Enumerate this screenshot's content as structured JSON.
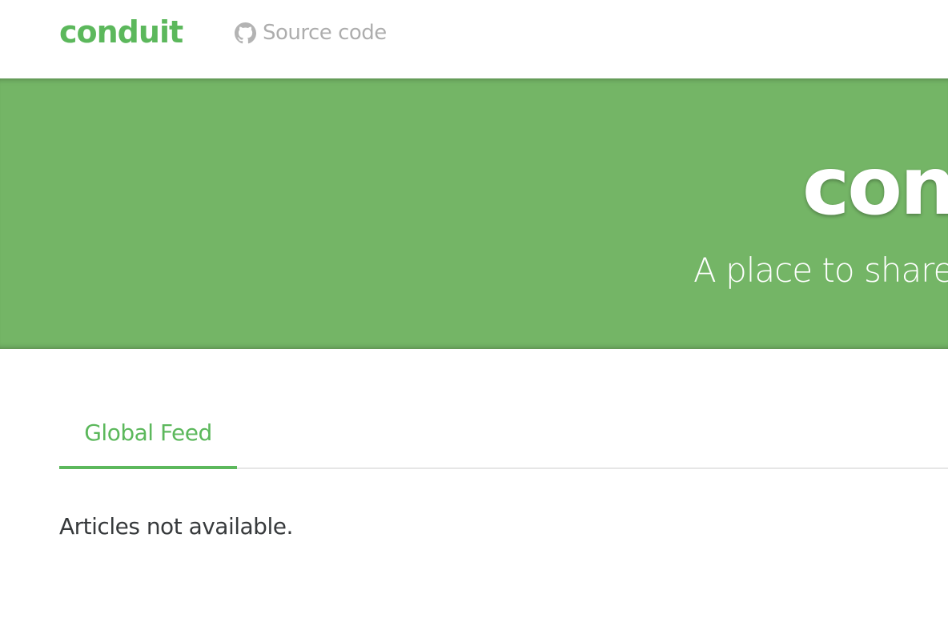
{
  "navbar": {
    "brand": "conduit",
    "source_link_label": "Source code",
    "source_icon": "github-icon"
  },
  "banner": {
    "title": "conduit",
    "subtitle": "A place to share your knowledge."
  },
  "feed": {
    "tabs": [
      {
        "label": "Global Feed",
        "active": true
      }
    ],
    "empty_message": "Articles not available."
  },
  "colors": {
    "brand_green": "#5cb85c",
    "banner_green": "#74b566",
    "muted_text": "#b3b3b3",
    "body_text": "#373a3c",
    "divider": "#e6e6e6"
  }
}
